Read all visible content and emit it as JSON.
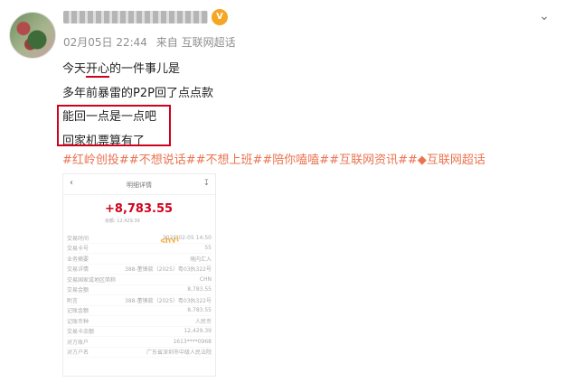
{
  "post": {
    "date": "02月05日 22:44",
    "source": "来自 互联网超话",
    "lines": [
      {
        "pre": "今天",
        "mark": "开心",
        "post": "的一件事儿是"
      },
      {
        "text": "多年前暴雷的P2P回了点点款"
      },
      {
        "text": "能回一点是一点吧"
      },
      {
        "text": "回家机票算有了"
      }
    ],
    "tags": [
      "#红岭创投#",
      "#不想说话#",
      "#不想上班#",
      "#陪你嗑嗑#",
      "#互联网资讯#",
      "#",
      "互联网超话"
    ]
  },
  "icons": {
    "vip": "vip-badge-icon",
    "chevron": "chevron-down-icon",
    "back": "back-icon",
    "download": "download-icon"
  },
  "colors": {
    "accent": "#eb7350",
    "highlight": "#d0021b",
    "meta": "#8f8f8f"
  },
  "screenshot": {
    "title": "明细详情",
    "amount": "+8,783.55",
    "balance": "余额: 12,429.39",
    "sticker": "shyi",
    "rows": [
      {
        "k": "交易时间",
        "v": "2025-02-05 14:50"
      },
      {
        "k": "交易卡号",
        "v": "55"
      },
      {
        "k": "业务摘要",
        "v": "境内汇入"
      },
      {
        "k": "交易详情",
        "v": "388-董锋款（2025）粤03执322号"
      },
      {
        "k": "交易国家或地区简称",
        "v": "CHN"
      },
      {
        "k": "交易金额",
        "v": "8,783.55"
      },
      {
        "k": "附言",
        "v": "388-董锋款（2025）粤03执322号"
      },
      {
        "k": "记账金额",
        "v": "8,783.55"
      },
      {
        "k": "记账币种",
        "v": "人民币"
      },
      {
        "k": "交易卡余额",
        "v": "12,429.39"
      },
      {
        "k": "对方账户",
        "v": "1613****0968"
      },
      {
        "k": "对方户名",
        "v": "广东省深圳市中级人民法院"
      }
    ]
  }
}
